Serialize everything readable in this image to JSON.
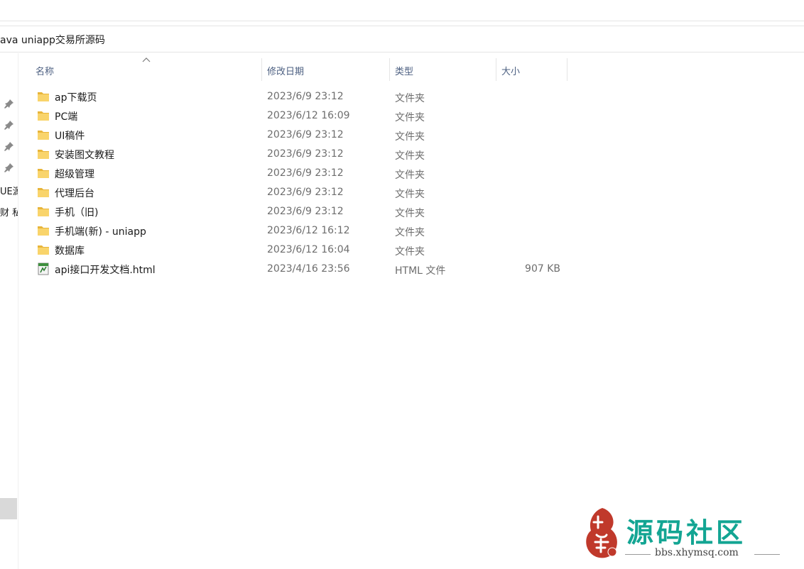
{
  "path": {
    "current": "ava uniapp交易所源码"
  },
  "nav": {
    "items": [
      {
        "label": "UE源"
      },
      {
        "label": "财 私"
      }
    ]
  },
  "columns": {
    "name": "名称",
    "date": "修改日期",
    "type": "类型",
    "size": "大小"
  },
  "files": [
    {
      "name": "ap下载页",
      "date": "2023/6/9 23:12",
      "type": "文件夹",
      "size": "",
      "icon": "folder-icon"
    },
    {
      "name": "PC端",
      "date": "2023/6/12 16:09",
      "type": "文件夹",
      "size": "",
      "icon": "folder-icon"
    },
    {
      "name": "UI稿件",
      "date": "2023/6/9 23:12",
      "type": "文件夹",
      "size": "",
      "icon": "folder-icon"
    },
    {
      "name": "安装图文教程",
      "date": "2023/6/9 23:12",
      "type": "文件夹",
      "size": "",
      "icon": "folder-icon"
    },
    {
      "name": "超级管理",
      "date": "2023/6/9 23:12",
      "type": "文件夹",
      "size": "",
      "icon": "folder-icon"
    },
    {
      "name": "代理后台",
      "date": "2023/6/9 23:12",
      "type": "文件夹",
      "size": "",
      "icon": "folder-icon"
    },
    {
      "name": "手机（旧)",
      "date": "2023/6/9 23:12",
      "type": "文件夹",
      "size": "",
      "icon": "folder-icon"
    },
    {
      "name": "手机端(新) - uniapp",
      "date": "2023/6/12 16:12",
      "type": "文件夹",
      "size": "",
      "icon": "folder-icon"
    },
    {
      "name": "数据库",
      "date": "2023/6/12 16:04",
      "type": "文件夹",
      "size": "",
      "icon": "folder-icon"
    },
    {
      "name": "api接口开发文档.html",
      "date": "2023/4/16 23:56",
      "type": "HTML 文件",
      "size": "907 KB",
      "icon": "html-file-icon"
    }
  ],
  "watermark": {
    "seal": "小小",
    "title": "源码社区",
    "url": "bbs.xhymsq.com"
  },
  "colors": {
    "folder": "#f5c542",
    "watermark": "#13a593",
    "seal": "#c0392b"
  }
}
